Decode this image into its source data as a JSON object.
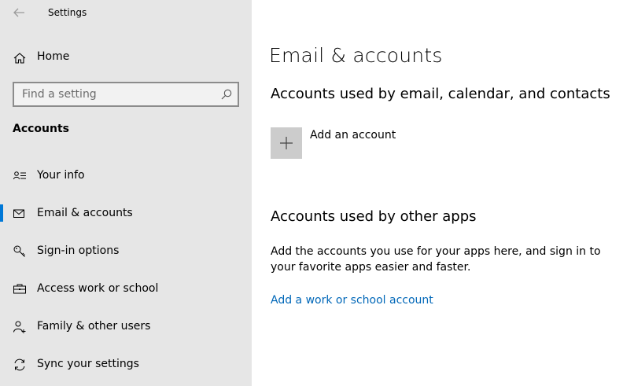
{
  "window": {
    "title": "Settings"
  },
  "sidebar": {
    "home_label": "Home",
    "search": {
      "placeholder": "Find a setting"
    },
    "section_title": "Accounts",
    "items": [
      {
        "label": "Your info",
        "icon": "person-card-icon"
      },
      {
        "label": "Email & accounts",
        "icon": "mail-icon",
        "selected": true
      },
      {
        "label": "Sign-in options",
        "icon": "key-icon"
      },
      {
        "label": "Access work or school",
        "icon": "briefcase-icon"
      },
      {
        "label": "Family & other users",
        "icon": "person-add-icon"
      },
      {
        "label": "Sync your settings",
        "icon": "sync-icon"
      }
    ]
  },
  "main": {
    "title": "Email & accounts",
    "email_section": {
      "heading": "Accounts used by email, calendar, and contacts",
      "add_account_label": "Add an account"
    },
    "other_apps_section": {
      "heading": "Accounts used by other apps",
      "description": "Add the accounts you use for your apps here, and sign in to your favorite apps easier and faster.",
      "link_label": "Add a work or school account"
    }
  },
  "colors": {
    "accent": "#0078d7",
    "link": "#0067b8",
    "sidebar_bg": "#e6e6e6",
    "tile_bg": "#cccccc"
  }
}
